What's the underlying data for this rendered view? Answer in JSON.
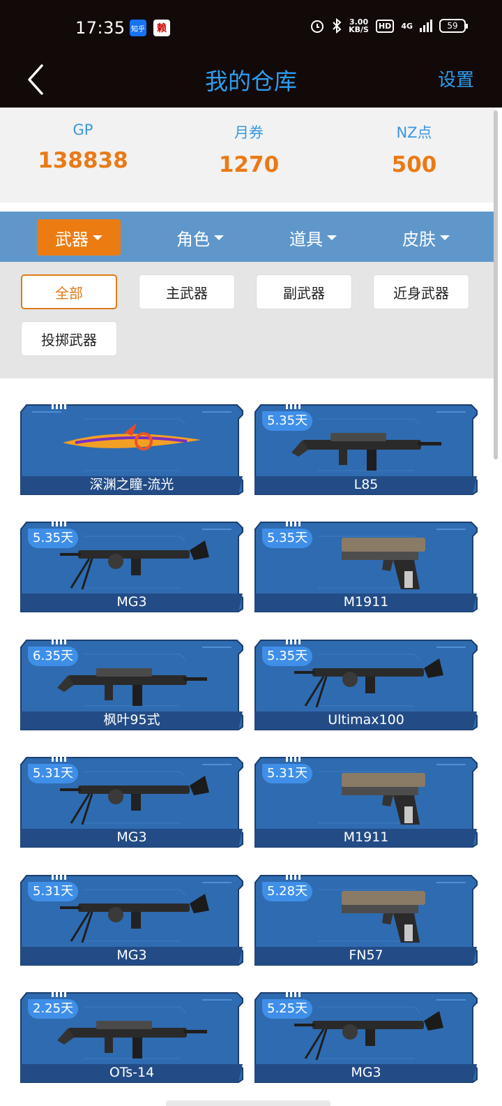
{
  "status_bar": {
    "time": "17:35",
    "app_badges": [
      "知乎",
      "赖"
    ],
    "speed_value": "3.00",
    "speed_unit": "KB/S",
    "hd": "HD",
    "network": "4G",
    "battery": "59"
  },
  "nav": {
    "title": "我的仓库",
    "settings": "设置"
  },
  "stats": [
    {
      "label": "GP",
      "value": "138838"
    },
    {
      "label": "月券",
      "value": "1270"
    },
    {
      "label": "NZ点",
      "value": "500"
    }
  ],
  "tabs": [
    {
      "label": "武器",
      "active": true
    },
    {
      "label": "角色",
      "active": false
    },
    {
      "label": "道具",
      "active": false
    },
    {
      "label": "皮肤",
      "active": false
    }
  ],
  "filters": [
    {
      "label": "全部",
      "active": true
    },
    {
      "label": "主武器",
      "active": false
    },
    {
      "label": "副武器",
      "active": false
    },
    {
      "label": "近身武器",
      "active": false
    },
    {
      "label": "投掷武器",
      "active": false
    }
  ],
  "items": [
    {
      "name": "深渊之瞳-流光",
      "days": "",
      "kind": "blade"
    },
    {
      "name": "L85",
      "days": "5.35天",
      "kind": "rifle"
    },
    {
      "name": "MG3",
      "days": "5.35天",
      "kind": "mg"
    },
    {
      "name": "M1911",
      "days": "5.35天",
      "kind": "pistol"
    },
    {
      "name": "枫叶95式",
      "days": "6.35天",
      "kind": "rifle"
    },
    {
      "name": "Ultimax100",
      "days": "5.35天",
      "kind": "mg"
    },
    {
      "name": "MG3",
      "days": "5.31天",
      "kind": "mg"
    },
    {
      "name": "M1911",
      "days": "5.31天",
      "kind": "pistol"
    },
    {
      "name": "MG3",
      "days": "5.31天",
      "kind": "mg"
    },
    {
      "name": "FN57",
      "days": "5.28天",
      "kind": "pistol"
    },
    {
      "name": "OTs-14",
      "days": "2.25天",
      "kind": "rifle"
    },
    {
      "name": "MG3",
      "days": "5.25天",
      "kind": "mg"
    }
  ],
  "colors": {
    "accent_orange": "#ec7c12",
    "title_blue": "#2e9df0",
    "tab_bar": "#5f97cb",
    "card_blue": "#2f6bb0",
    "badge_blue": "#3f8fe8"
  }
}
